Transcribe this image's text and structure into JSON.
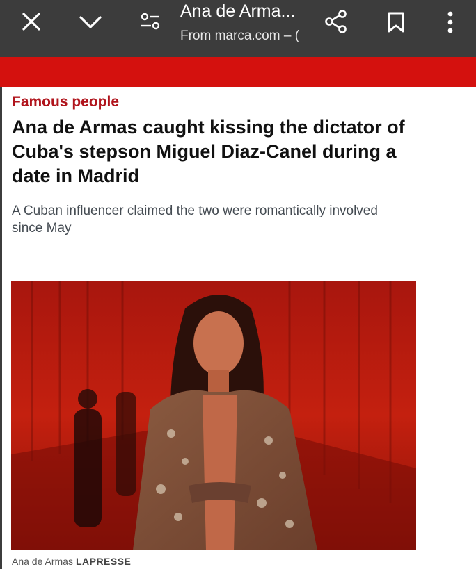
{
  "toolbar": {
    "title": "Ana de Arma...",
    "subtitle": "From marca.com – (",
    "icons": [
      "close-icon",
      "chevron-down-icon",
      "page-settings-icon",
      "share-icon",
      "bookmark-icon",
      "more-vert-icon"
    ]
  },
  "colors": {
    "toolbar": "#3c3c3c",
    "banner": "#d4110e",
    "category": "#b0141c"
  },
  "article": {
    "category": "Famous people",
    "headline": "Ana de Armas caught kissing the dictator of Cuba's stepson Miguel Diaz-Canel during a date in Madrid",
    "subheadline": "A Cuban influencer claimed the two were romantically involved since May",
    "caption": "Ana de Armas",
    "credit": "LAPRESSE"
  }
}
